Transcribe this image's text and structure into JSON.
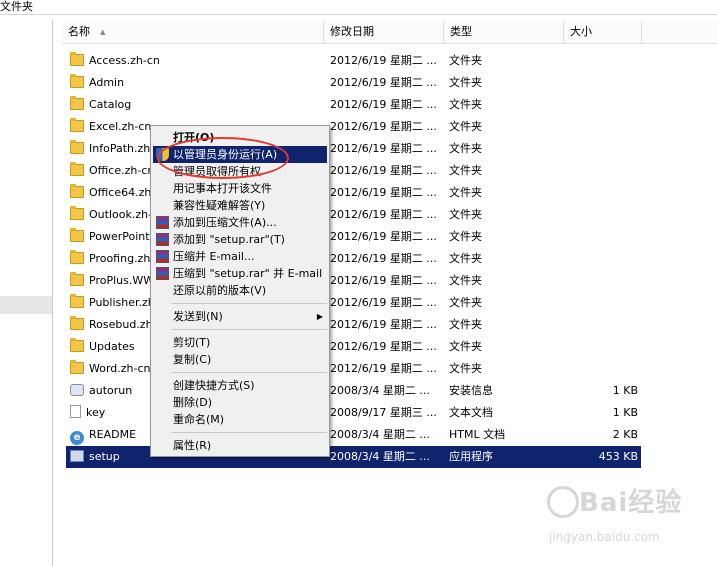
{
  "breadcrumb": "文件夹",
  "columns": {
    "name": "名称",
    "date": "修改日期",
    "type": "类型",
    "size": "大小"
  },
  "files": [
    {
      "name": "Access.zh-cn",
      "date": "2012/6/19 星期二 ...",
      "type": "文件夹",
      "size": "",
      "icon": "folder-icon"
    },
    {
      "name": "Admin",
      "date": "2012/6/19 星期二 ...",
      "type": "文件夹",
      "size": "",
      "icon": "folder-icon"
    },
    {
      "name": "Catalog",
      "date": "2012/6/19 星期二 ...",
      "type": "文件夹",
      "size": "",
      "icon": "folder-icon"
    },
    {
      "name": "Excel.zh-cn",
      "date": "2012/6/19 星期二 ...",
      "type": "文件夹",
      "size": "",
      "icon": "folder-icon"
    },
    {
      "name": "InfoPath.zh",
      "date": "2012/6/19 星期二 ...",
      "type": "文件夹",
      "size": "",
      "icon": "folder-icon"
    },
    {
      "name": "Office.zh-cn",
      "date": "2012/6/19 星期二 ...",
      "type": "文件夹",
      "size": "",
      "icon": "folder-icon"
    },
    {
      "name": "Office64.zh-",
      "date": "2012/6/19 星期二 ...",
      "type": "文件夹",
      "size": "",
      "icon": "folder-icon"
    },
    {
      "name": "Outlook.zh-c",
      "date": "2012/6/19 星期二 ...",
      "type": "文件夹",
      "size": "",
      "icon": "folder-icon"
    },
    {
      "name": "PowerPoint.z",
      "date": "2012/6/19 星期二 ...",
      "type": "文件夹",
      "size": "",
      "icon": "folder-icon"
    },
    {
      "name": "Proofing.zh-",
      "date": "2012/6/19 星期二 ...",
      "type": "文件夹",
      "size": "",
      "icon": "folder-icon"
    },
    {
      "name": "ProPlus.WW",
      "date": "2012/6/19 星期二 ...",
      "type": "文件夹",
      "size": "",
      "icon": "folder-icon"
    },
    {
      "name": "Publisher.zh-",
      "date": "2012/6/19 星期二 ...",
      "type": "文件夹",
      "size": "",
      "icon": "folder-icon"
    },
    {
      "name": "Rosebud.zh-",
      "date": "2012/6/19 星期二 ...",
      "type": "文件夹",
      "size": "",
      "icon": "folder-icon"
    },
    {
      "name": "Updates",
      "date": "2012/6/19 星期二 ...",
      "type": "文件夹",
      "size": "",
      "icon": "folder-icon"
    },
    {
      "name": "Word.zh-cn",
      "date": "2012/6/19 星期二 ...",
      "type": "文件夹",
      "size": "",
      "icon": "folder-icon"
    },
    {
      "name": "autorun",
      "date": "2008/3/4 星期二 ...",
      "type": "安装信息",
      "size": "1 KB",
      "icon": "settings-file-icon"
    },
    {
      "name": "key",
      "date": "2008/9/17 星期三 ...",
      "type": "文本文档",
      "size": "1 KB",
      "icon": "text-file-icon"
    },
    {
      "name": "README",
      "date": "2008/3/4 星期二 ...",
      "type": "HTML 文档",
      "size": "2 KB",
      "icon": "html-file-icon"
    },
    {
      "name": "setup",
      "date": "2008/3/4 星期二 ...",
      "type": "应用程序",
      "size": "453 KB",
      "icon": "application-icon",
      "selected": true
    }
  ],
  "context_menu": {
    "open": "打开(O)",
    "run_as_admin": "以管理员身份运行(A)",
    "take_ownership": "管理员取得所有权",
    "open_with_notepad": "用记事本打开该文件",
    "troubleshoot_compat": "兼容性疑难解答(Y)",
    "add_to_archive": "添加到压缩文件(A)...",
    "add_to_setup_rar": "添加到 \"setup.rar\"(T)",
    "compress_email": "压缩并 E-mail...",
    "compress_setup_email": "压缩到 \"setup.rar\" 并 E-mail",
    "restore_previous": "还原以前的版本(V)",
    "send_to": "发送到(N)",
    "cut": "剪切(T)",
    "copy": "复制(C)",
    "create_shortcut": "创建快捷方式(S)",
    "delete": "删除(D)",
    "rename": "重命名(M)",
    "properties": "属性(R)"
  },
  "watermark": {
    "brand": "Bai经验",
    "url": "jingyan.baidu.com"
  },
  "colors": {
    "selection": "#10236d",
    "highlight_ring": "#e53a2f",
    "folder": "#f3c64a"
  }
}
